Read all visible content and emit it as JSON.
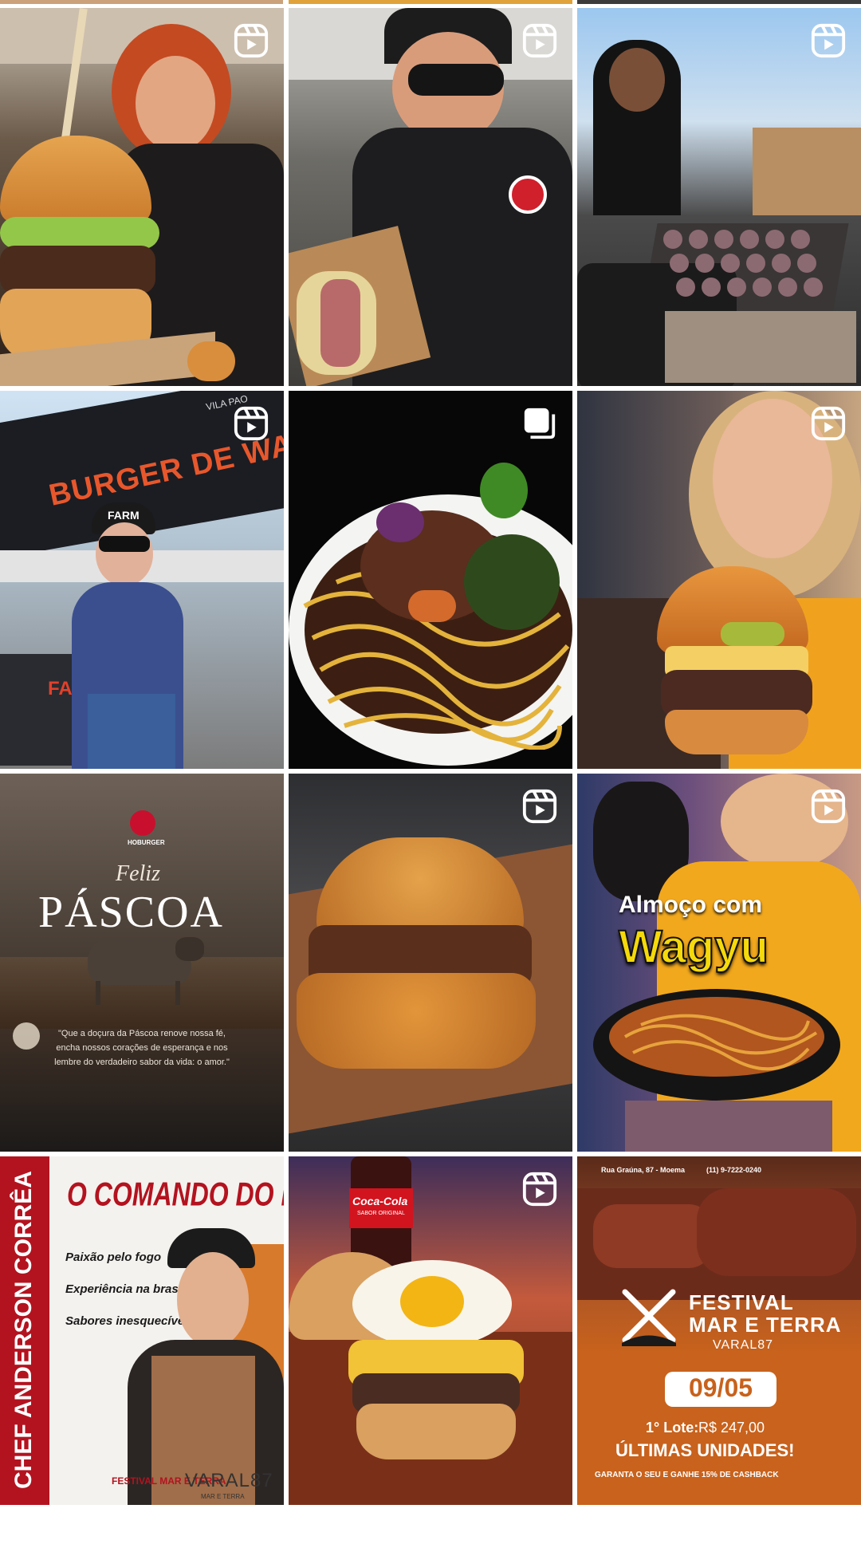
{
  "grid": {
    "tiles": [
      {
        "id": "post-1",
        "kind": "reel"
      },
      {
        "id": "post-2",
        "kind": "reel"
      },
      {
        "id": "post-3",
        "kind": "reel"
      },
      {
        "id": "post-4",
        "kind": "reel",
        "banner": "BURGER DE WAGYU",
        "brand": "FARM",
        "brand_small": "VILA PAO"
      },
      {
        "id": "post-5",
        "kind": "carousel"
      },
      {
        "id": "post-6",
        "kind": "reel"
      },
      {
        "id": "post-7",
        "kind": "image",
        "logo": "HOBURGER",
        "script": "Feliz",
        "headline": "PÁSCOA",
        "quote_line1": "\"Que a doçura da Páscoa renove nossa fé,",
        "quote_line2": "encha nossos corações de esperança e nos",
        "quote_line3": "lembre do verdadeiro sabor da vida: o amor.\""
      },
      {
        "id": "post-8",
        "kind": "reel"
      },
      {
        "id": "post-9",
        "kind": "reel",
        "title_top": "Almoço com",
        "title_big": "Wagyu"
      },
      {
        "id": "post-10",
        "kind": "image",
        "vertical": "CHEF ANDERSON CORRÊA",
        "headline": "O COMANDO DO FOGO",
        "line1": "Paixão pelo fogo",
        "line2": "Experiência na brasa",
        "line3": "Sabores inesquecíveis!",
        "logo1": "FESTIVAL MAR E TERRA",
        "logo2": "VARAL87",
        "logo2_sub": "MAR E TERRA"
      },
      {
        "id": "post-11",
        "kind": "reel",
        "bottle_label": "Coca-Cola",
        "bottle_sub": "SABOR ORIGINAL"
      },
      {
        "id": "post-12",
        "kind": "image",
        "address": "Rua Graúna, 87 - Moema",
        "phone": "(11) 9-7222-0240",
        "festival_l1": "FESTIVAL",
        "festival_l2": "MAR E TERRA",
        "venue": "VARAL87",
        "date": "09/05",
        "lot_label": "1° Lote:",
        "lot_price": "R$ 247,00",
        "last": "ÚLTIMAS UNIDADES!",
        "cashback": "GARANTA O SEU E GANHE 15% DE CASHBACK"
      }
    ]
  },
  "colors": {
    "background": "#ffffff",
    "badge": "#ffffff",
    "accent_red": "#c8102e",
    "accent_orange": "#c8621c",
    "wagyu_yellow": "#f5d90a"
  },
  "icons": {
    "reel": "reels-icon",
    "carousel": "carousel-icon"
  }
}
